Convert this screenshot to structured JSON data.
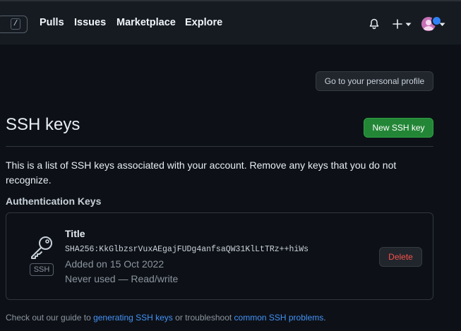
{
  "header": {
    "search_shortcut": "/",
    "nav": [
      "Pulls",
      "Issues",
      "Marketplace",
      "Explore"
    ],
    "icons": [
      "bell-icon",
      "plus-icon",
      "chevron-down-icon",
      "avatar"
    ]
  },
  "main": {
    "profile_button": "Go to your personal profile",
    "title": "SSH keys",
    "new_key_button": "New SSH key",
    "description": "This is a list of SSH keys associated with your account. Remove any keys that you do not recognize.",
    "section_heading": "Authentication Keys",
    "key": {
      "badge": "SSH",
      "title": "Title",
      "fingerprint": "SHA256:KkGlbzsrVuxAEgajFUDg4anfsaQW31KlLtTRz++hiWs",
      "added": "Added on 15 Oct 2022",
      "usage": "Never used — Read/write",
      "delete_label": "Delete"
    },
    "footer": {
      "prefix": "Check out our guide to ",
      "link1": "generating SSH keys",
      "middle": " or troubleshoot ",
      "link2": "common SSH problems",
      "suffix": "."
    }
  },
  "colors": {
    "background": "#0d1117",
    "header": "#161b22",
    "accent_green": "#238636",
    "danger": "#f85149",
    "link": "#4493f8"
  }
}
